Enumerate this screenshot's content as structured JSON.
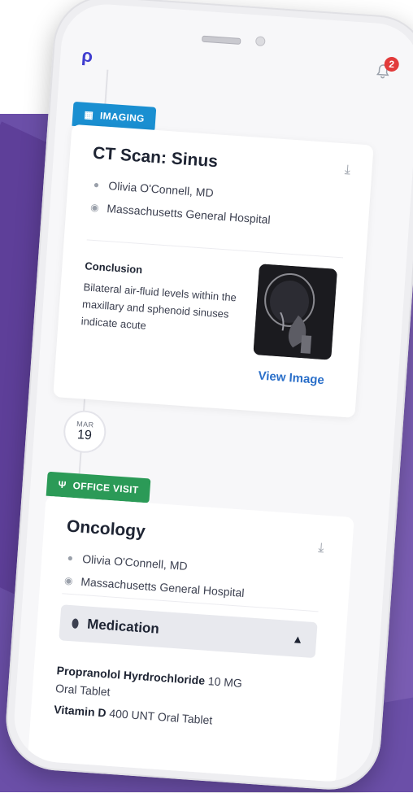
{
  "header": {
    "logo_text": "ρ",
    "notification_count": "2",
    "bell_icon": "bell-icon"
  },
  "imaging_card": {
    "tag_label": "IMAGING",
    "tag_color": "#1a8fd1",
    "title": "CT Scan: Sinus",
    "doctor": "Olivia O'Connell, MD",
    "location": "Massachusetts General Hospital",
    "conclusion_label": "Conclusion",
    "conclusion_text": "Bilateral air-fluid levels within the maxillary and sphenoid sinuses indicate acute",
    "view_image_label": "View Image"
  },
  "date_marker": {
    "month": "MAR",
    "day": "19"
  },
  "office_card": {
    "tag_label": "OFFICE VISIT",
    "tag_color": "#2b9a57",
    "title": "Oncology",
    "doctor": "Olivia O'Connell, MD",
    "location": "Massachusetts General Hospital",
    "medication_header": "Medication",
    "medications": [
      {
        "name": "Propranolol Hyrdrochloride",
        "dose": "10 MG",
        "form": "Oral Tablet"
      },
      {
        "name": "Vitamin D",
        "dose": "400 UNT",
        "form": "Oral Tablet"
      }
    ]
  },
  "colors": {
    "accent_link": "#2a6fc9",
    "background_purple": "#6b4fa8",
    "badge_red": "#e23b3b"
  }
}
